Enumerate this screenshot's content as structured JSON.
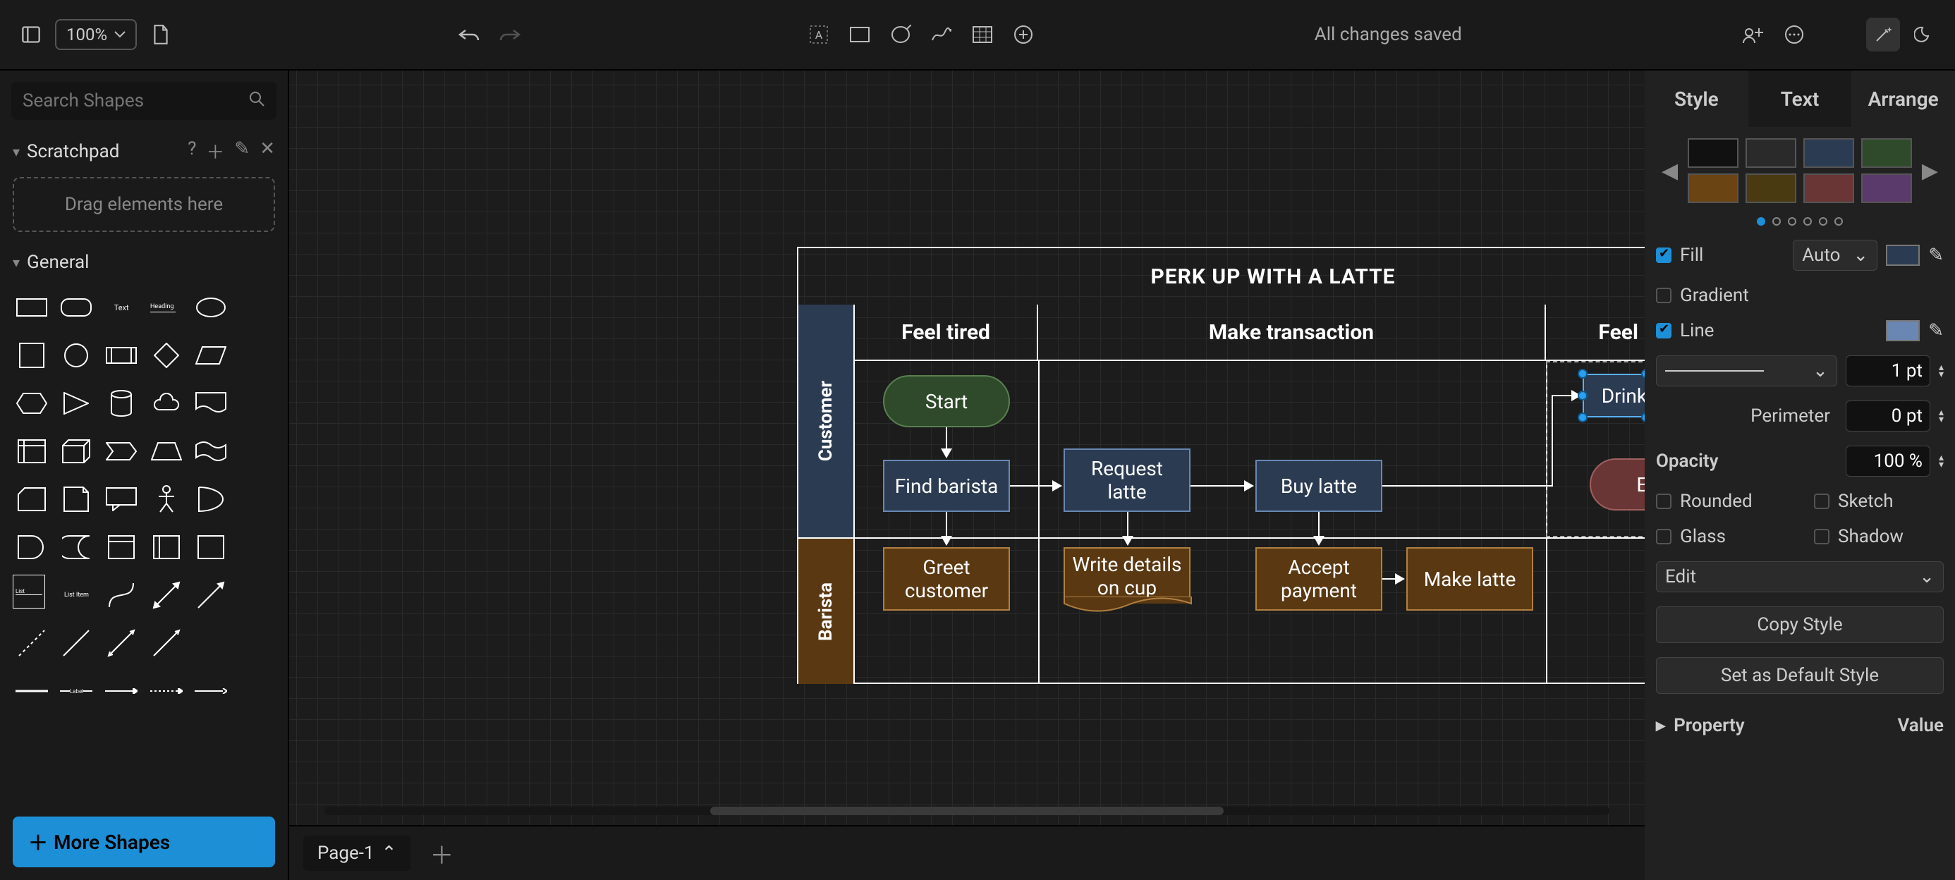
{
  "toolbar": {
    "zoom": "100%",
    "status": "All changes saved"
  },
  "left": {
    "search_placeholder": "Search Shapes",
    "scratchpad": {
      "title": "Scratchpad",
      "drop_hint": "Drag elements here"
    },
    "general": {
      "title": "General",
      "text_label": "Text",
      "heading_label": "Heading",
      "list_label": "List",
      "list_item_label": "List Item",
      "label_label": "Label"
    },
    "more_shapes": "More Shapes"
  },
  "pages": {
    "page1": "Page-1"
  },
  "right": {
    "tabs": {
      "style": "Style",
      "text": "Text",
      "arrange": "Arrange"
    },
    "swatches": [
      "#111111",
      "#2a2a2a",
      "#2b3b52",
      "#2e4a2a",
      "#6a4412",
      "#4a3a12",
      "#6a3535",
      "#5a3a6a"
    ],
    "fill": {
      "label": "Fill",
      "mode": "Auto",
      "color": "#2b3b52"
    },
    "gradient": "Gradient",
    "line": {
      "label": "Line",
      "color": "#6a87b3",
      "width": "1 pt",
      "perimeter_label": "Perimeter",
      "perimeter": "0 pt"
    },
    "opacity": {
      "label": "Opacity",
      "value": "100 %"
    },
    "checks": {
      "rounded": "Rounded",
      "sketch": "Sketch",
      "glass": "Glass",
      "shadow": "Shadow"
    },
    "edit": "Edit",
    "copy_style": "Copy Style",
    "set_default": "Set as Default Style",
    "property": "Property",
    "value": "Value"
  },
  "diagram": {
    "title": "PERK UP WITH A LATTE",
    "lanes": {
      "customer": "Customer",
      "barista": "Barista"
    },
    "phases": {
      "p1": "Feel tired",
      "p2": "Make transaction",
      "p3": "Feel perky"
    },
    "nodes": {
      "start": "Start",
      "find_barista": "Find barista",
      "request_latte": "Request latte",
      "buy_latte": "Buy latte",
      "drink_latte": "Drink latte",
      "end": "End",
      "greet_customer": "Greet customer",
      "write_details": "Write details on cup",
      "accept_payment": "Accept payment",
      "make_latte": "Make latte"
    }
  }
}
